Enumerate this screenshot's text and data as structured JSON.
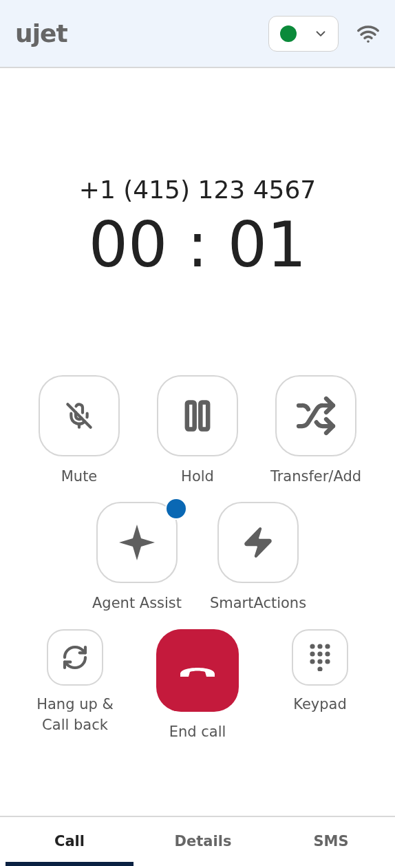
{
  "header": {
    "logo": "ujet",
    "status": {
      "color": "#0b8a3a"
    }
  },
  "call": {
    "number": "+1 (415) 123 4567",
    "timer": "00 : 01"
  },
  "action_rows": [
    [
      {
        "kind": "mute",
        "label": "Mute"
      },
      {
        "kind": "hold",
        "label": "Hold"
      },
      {
        "kind": "transfer",
        "label": "Transfer/Add"
      }
    ],
    [
      {
        "kind": "assist",
        "label": "Agent Assist",
        "color": "#0a68b4"
      },
      {
        "kind": "smart",
        "label": "SmartActions"
      }
    ],
    [
      {
        "kind": "callback",
        "label": "Hang up &\nCall back"
      },
      {
        "kind": "end",
        "label": "End call"
      },
      {
        "kind": "keypad",
        "label": "Keypad"
      }
    ]
  ],
  "tabs": [
    {
      "label": "Call",
      "selected": true
    },
    {
      "label": "Details",
      "selected": false
    },
    {
      "label": "SMS",
      "selected": false
    }
  ]
}
